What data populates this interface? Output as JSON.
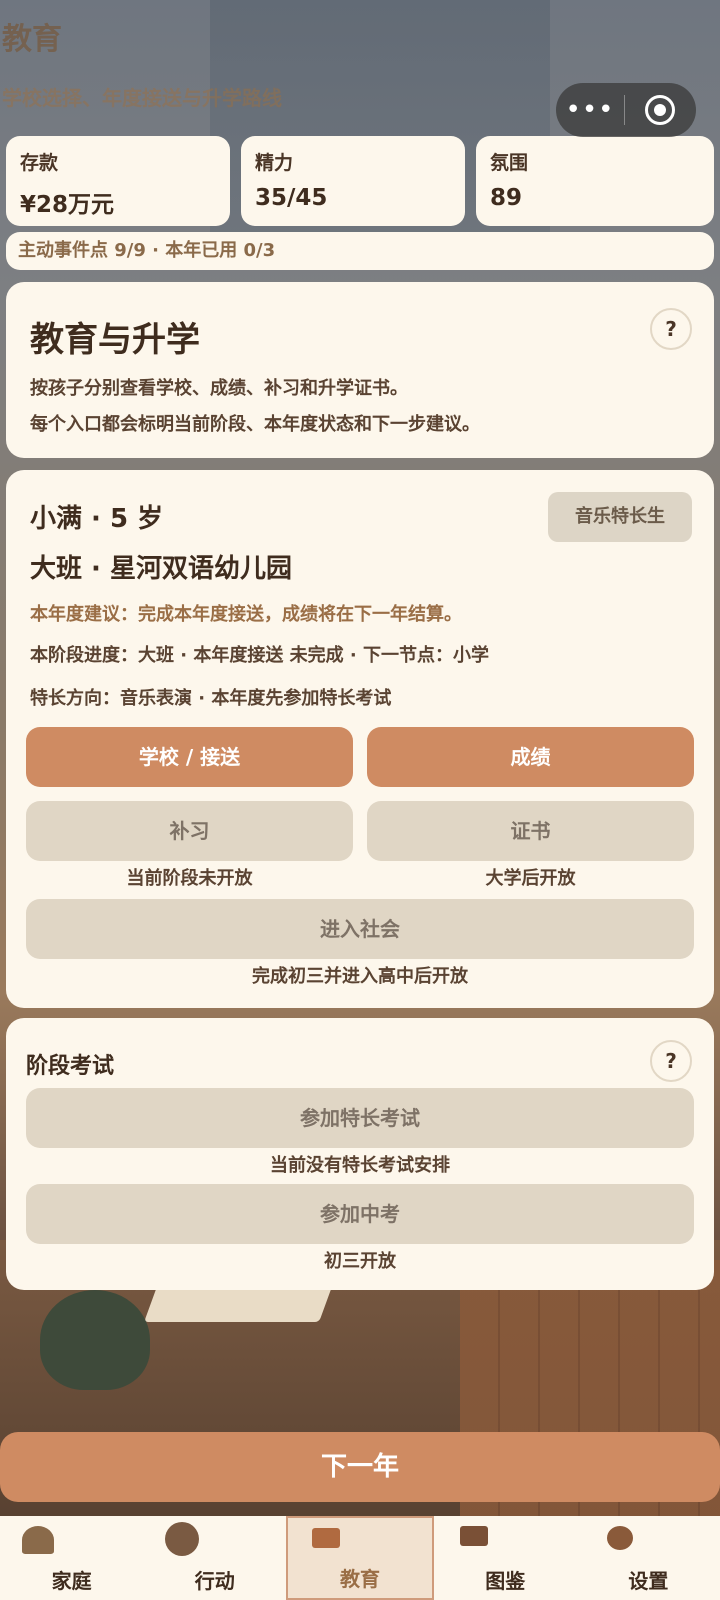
{
  "page": {
    "ghost_title": "教育",
    "ghost_subtitle": "学校选择、年度接送与升学路线"
  },
  "capsule": {
    "more_icon": "more-dots-icon",
    "close_icon": "target-circle-icon"
  },
  "stats": [
    {
      "label": "存款",
      "value": "¥28万元"
    },
    {
      "label": "精力",
      "value": "35/45"
    },
    {
      "label": "氛围",
      "value": "89"
    }
  ],
  "event_points": "主动事件点 9/9 · 本年已用 0/3",
  "intro": {
    "title": "教育与升学",
    "line1": "按孩子分别查看学校、成绩、补习和升学证书。",
    "line2": "每个入口都会标明当前阶段、本年度状态和下一步建议。",
    "help": "?"
  },
  "child": {
    "name_age": "小满 · 5 岁",
    "school": "大班 · 星河双语幼儿园",
    "badge": "音乐特长生",
    "suggestion": "本年度建议：完成本年度接送，成绩将在下一年结算。",
    "progress": "本阶段进度：大班 · 本年度接送 未完成 · 下一节点：小学",
    "talent": "特长方向：音乐表演 · 本年度先参加特长考试",
    "buttons": {
      "school": "学校 / 接送",
      "grades": "成绩",
      "tutoring": "补习",
      "certificate": "证书",
      "society": "进入社会"
    },
    "notes": {
      "tutoring": "当前阶段未开放",
      "certificate": "大学后开放",
      "society": "完成初三并进入高中后开放"
    }
  },
  "exams": {
    "title": "阶段考试",
    "help": "?",
    "talent_exam": "参加特长考试",
    "talent_note": "当前没有特长考试安排",
    "zhongkao": "参加中考",
    "zhongkao_note": "初三开放"
  },
  "next_year": "下一年",
  "tabs": [
    {
      "label": "家庭",
      "icon": "family-icon"
    },
    {
      "label": "行动",
      "icon": "action-icon"
    },
    {
      "label": "教育",
      "icon": "education-book-icon"
    },
    {
      "label": "图鉴",
      "icon": "collection-book-icon"
    },
    {
      "label": "设置",
      "icon": "settings-icon"
    }
  ],
  "colors": {
    "accent": "#cf8b62",
    "card": "#fdf7ec",
    "disabled": "#e0d6c5"
  }
}
